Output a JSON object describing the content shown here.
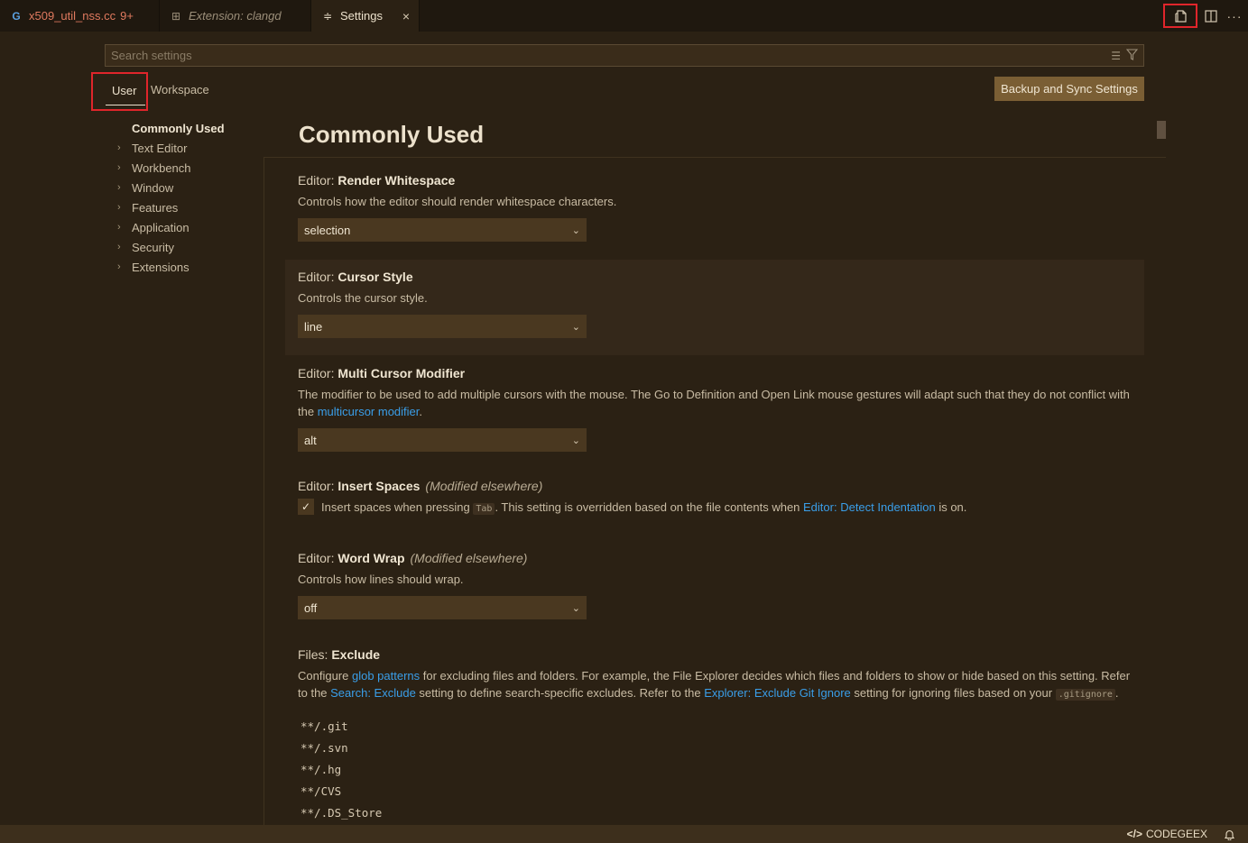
{
  "tabs": [
    {
      "icon": "cpp-file-icon",
      "label": "x509_util_nss.cc",
      "badge": "9+"
    },
    {
      "icon": "extension-icon",
      "label": "Extension: clangd"
    },
    {
      "icon": "settings-icon",
      "label": "Settings",
      "close": "×"
    }
  ],
  "search": {
    "placeholder": "Search settings",
    "value": ""
  },
  "scopes": {
    "user": "User",
    "workspace": "Workspace"
  },
  "backup_button": "Backup and Sync Settings",
  "toc": {
    "active": "Commonly Used",
    "items": [
      "Text Editor",
      "Workbench",
      "Window",
      "Features",
      "Application",
      "Security",
      "Extensions"
    ]
  },
  "section_title": "Commonly Used",
  "settings": {
    "render_whitespace": {
      "category": "Editor: ",
      "name": "Render Whitespace",
      "description": "Controls how the editor should render whitespace characters.",
      "value": "selection"
    },
    "cursor_style": {
      "category": "Editor: ",
      "name": "Cursor Style",
      "description": "Controls the cursor style.",
      "value": "line"
    },
    "multi_cursor": {
      "category": "Editor: ",
      "name": "Multi Cursor Modifier",
      "desc_part1": "The modifier to be used to add multiple cursors with the mouse. The Go to Definition and Open Link mouse gestures will adapt such that they do not conflict with the ",
      "desc_link": "multicursor modifier",
      "desc_part2": ".",
      "value": "alt"
    },
    "insert_spaces": {
      "category": "Editor: ",
      "name": "Insert Spaces",
      "modified": "(Modified elsewhere)",
      "checked": true,
      "desc_part1": "Insert spaces when pressing ",
      "desc_code": "Tab",
      "desc_part2": ". This setting is overridden based on the file contents when ",
      "desc_link": "Editor: Detect Indentation",
      "desc_part3": " is on."
    },
    "word_wrap": {
      "category": "Editor: ",
      "name": "Word Wrap",
      "modified": "(Modified elsewhere)",
      "description": "Controls how lines should wrap.",
      "value": "off"
    },
    "files_exclude": {
      "category": "Files: ",
      "name": "Exclude",
      "d1": "Configure ",
      "link1": "glob patterns",
      "d2": " for excluding files and folders. For example, the File Explorer decides which files and folders to show or hide based on this setting. Refer to the ",
      "link2": "Search: Exclude",
      "d3": " setting to define search-specific excludes. Refer to the ",
      "link3": "Explorer: Exclude Git Ignore",
      "d4": " setting for ignoring files based on your ",
      "code": ".gitignore",
      "d5": ".",
      "patterns": [
        "**/.git",
        "**/.svn",
        "**/.hg",
        "**/CVS",
        "**/.DS_Store"
      ]
    }
  },
  "statusbar": {
    "codegeex": "CODEGEEX"
  },
  "colors": {
    "accent_link": "#3a9ee8",
    "highlight_box": "#e0252b",
    "background": "#2b2114"
  }
}
